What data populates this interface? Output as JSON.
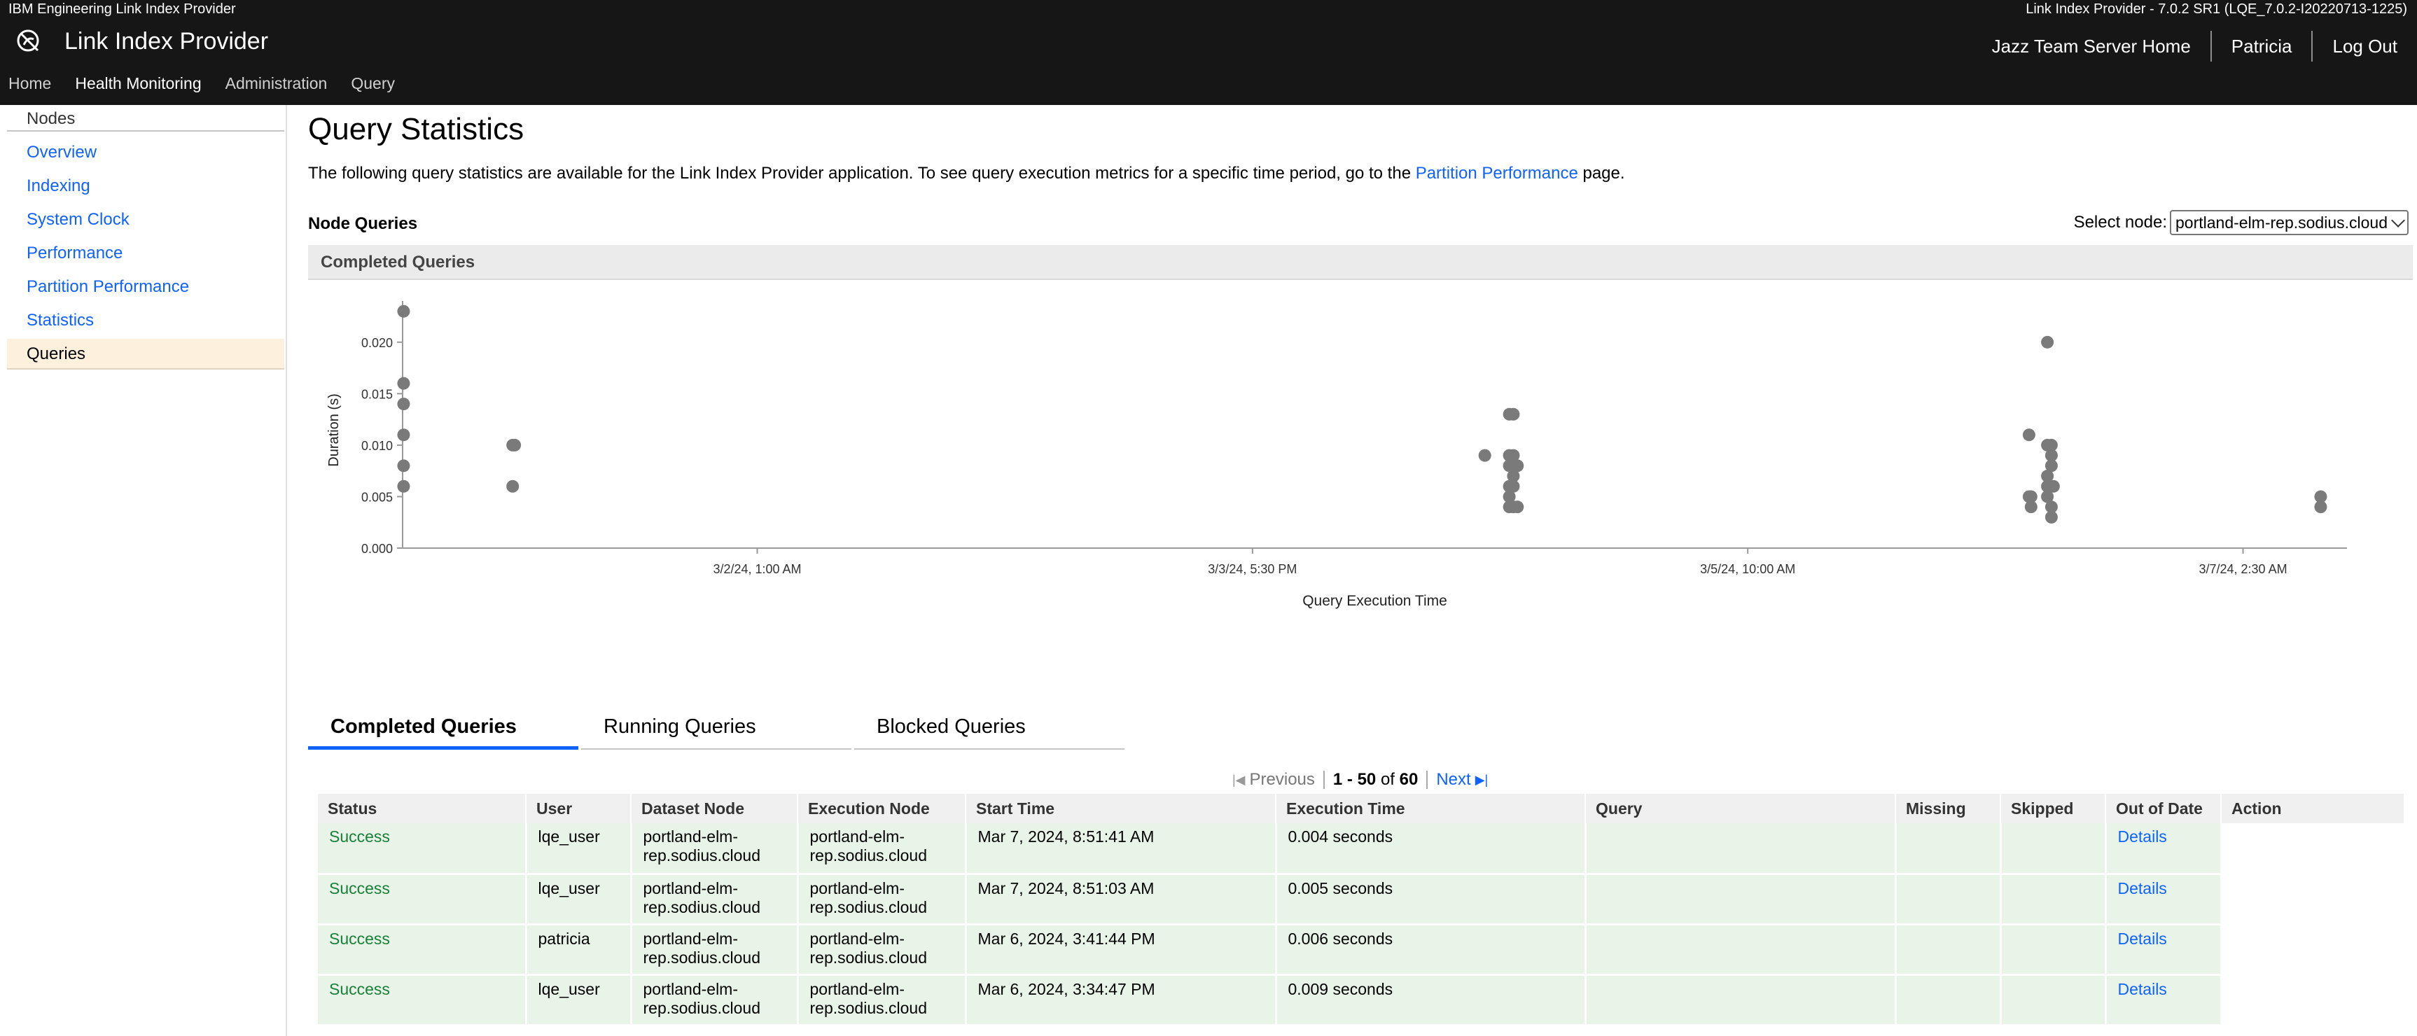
{
  "header": {
    "product": "IBM Engineering Link Index Provider",
    "version": "Link Index Provider - 7.0.2 SR1 (LQE_7.0.2-I20220713-1225)",
    "app_title": "Link Index Provider",
    "links": [
      "Jazz Team Server Home",
      "Patricia",
      "Log Out"
    ],
    "nav": [
      "Home",
      "Health Monitoring",
      "Administration",
      "Query"
    ],
    "active_nav": "Health Monitoring"
  },
  "sidebar": {
    "heading": "Nodes",
    "items": [
      "Overview",
      "Indexing",
      "System Clock",
      "Performance",
      "Partition Performance",
      "Statistics",
      "Queries"
    ],
    "active": "Queries"
  },
  "main": {
    "title": "Query Statistics",
    "intro_text": "The following query statistics are available for the Link Index Provider application. To see query execution metrics for a specific time period, go to the ",
    "intro_link": "Partition Performance",
    "intro_end": " page.",
    "node_queries_label": "Node Queries",
    "select_node_label": "Select node:",
    "select_node_value": "portland-elm-rep.sodius.cloud",
    "section_heading": "Completed Queries",
    "tabs": [
      "Completed Queries",
      "Running Queries",
      "Blocked Queries"
    ],
    "pager": {
      "previous": "Previous",
      "range": "1 - 50",
      "of_label": "of",
      "total": "60",
      "next": "Next"
    },
    "table": {
      "columns": [
        "Status",
        "User",
        "Dataset Node",
        "Execution Node",
        "Start Time",
        "Execution Time",
        "Query",
        "Missing",
        "Skipped",
        "Out of Date",
        "Action"
      ],
      "rows": [
        {
          "status": "Success",
          "user": "lqe_user",
          "dataset_node": "portland-elm-rep.sodius.cloud",
          "execution_node": "portland-elm-rep.sodius.cloud",
          "start_time": "Mar 7, 2024, 8:51:41 AM",
          "execution_time": "0.004 seconds",
          "query": "",
          "missing": "",
          "skipped": "",
          "out_of_date": "Details",
          "action": ""
        },
        {
          "status": "Success",
          "user": "lqe_user",
          "dataset_node": "portland-elm-rep.sodius.cloud",
          "execution_node": "portland-elm-rep.sodius.cloud",
          "start_time": "Mar 7, 2024, 8:51:03 AM",
          "execution_time": "0.005 seconds",
          "query": "",
          "missing": "",
          "skipped": "",
          "out_of_date": "Details",
          "action": ""
        },
        {
          "status": "Success",
          "user": "patricia",
          "dataset_node": "portland-elm-rep.sodius.cloud",
          "execution_node": "portland-elm-rep.sodius.cloud",
          "start_time": "Mar 6, 2024, 3:41:44 PM",
          "execution_time": "0.006 seconds",
          "query": "",
          "missing": "",
          "skipped": "",
          "out_of_date": "Details",
          "action": ""
        },
        {
          "status": "Success",
          "user": "lqe_user",
          "dataset_node": "portland-elm-rep.sodius.cloud",
          "execution_node": "portland-elm-rep.sodius.cloud",
          "start_time": "Mar 6, 2024, 3:34:47 PM",
          "execution_time": "0.009 seconds",
          "query": "",
          "missing": "",
          "skipped": "",
          "out_of_date": "Details",
          "action": ""
        }
      ]
    }
  },
  "colors": {
    "header_bg": "#161616",
    "link": "#0f62fe",
    "success": "#198038",
    "row_bg": "#e8f4e8",
    "point": "#7a7a7a",
    "active_side": "#fdf1de"
  },
  "chart_data": {
    "type": "scatter",
    "title": "",
    "xlabel": "Query Execution Time",
    "ylabel": "Duration (s)",
    "ylim": [
      0,
      0.024
    ],
    "y_ticks": [
      "0.000",
      "0.005",
      "0.010",
      "0.015",
      "0.020"
    ],
    "x_ticks": [
      "3/2/24, 1:00 AM",
      "3/3/24, 5:30 PM",
      "3/5/24, 10:00 AM",
      "3/7/24, 2:30 AM"
    ],
    "xlim": [
      "2024-02-29T20:00",
      "2024-03-07T11:00"
    ],
    "grid": false,
    "series": [
      {
        "points": [
          {
            "x": "2024-02-29T20:05",
            "y": 0.023
          },
          {
            "x": "2024-02-29T20:05",
            "y": 0.016
          },
          {
            "x": "2024-02-29T20:05",
            "y": 0.014
          },
          {
            "x": "2024-02-29T20:05",
            "y": 0.011
          },
          {
            "x": "2024-02-29T20:05",
            "y": 0.008
          },
          {
            "x": "2024-02-29T20:05",
            "y": 0.006
          },
          {
            "x": "2024-03-01T05:00",
            "y": 0.01
          },
          {
            "x": "2024-03-01T05:10",
            "y": 0.01
          },
          {
            "x": "2024-03-01T05:00",
            "y": 0.006
          },
          {
            "x": "2024-03-04T12:30",
            "y": 0.009
          },
          {
            "x": "2024-03-04T14:30",
            "y": 0.013
          },
          {
            "x": "2024-03-04T14:50",
            "y": 0.013
          },
          {
            "x": "2024-03-04T14:30",
            "y": 0.009
          },
          {
            "x": "2024-03-04T14:50",
            "y": 0.009
          },
          {
            "x": "2024-03-04T14:30",
            "y": 0.008
          },
          {
            "x": "2024-03-04T15:10",
            "y": 0.008
          },
          {
            "x": "2024-03-04T14:50",
            "y": 0.007
          },
          {
            "x": "2024-03-04T14:30",
            "y": 0.006
          },
          {
            "x": "2024-03-04T14:50",
            "y": 0.006
          },
          {
            "x": "2024-03-04T14:30",
            "y": 0.005
          },
          {
            "x": "2024-03-04T14:30",
            "y": 0.004
          },
          {
            "x": "2024-03-04T14:50",
            "y": 0.004
          },
          {
            "x": "2024-03-04T15:10",
            "y": 0.004
          },
          {
            "x": "2024-03-06T09:00",
            "y": 0.011
          },
          {
            "x": "2024-03-06T09:00",
            "y": 0.005
          },
          {
            "x": "2024-03-06T09:10",
            "y": 0.005
          },
          {
            "x": "2024-03-06T09:10",
            "y": 0.004
          },
          {
            "x": "2024-03-06T10:30",
            "y": 0.02
          },
          {
            "x": "2024-03-06T10:30",
            "y": 0.01
          },
          {
            "x": "2024-03-06T10:50",
            "y": 0.01
          },
          {
            "x": "2024-03-06T10:50",
            "y": 0.009
          },
          {
            "x": "2024-03-06T10:50",
            "y": 0.008
          },
          {
            "x": "2024-03-06T10:30",
            "y": 0.007
          },
          {
            "x": "2024-03-06T10:30",
            "y": 0.006
          },
          {
            "x": "2024-03-06T11:00",
            "y": 0.006
          },
          {
            "x": "2024-03-06T10:30",
            "y": 0.005
          },
          {
            "x": "2024-03-06T10:50",
            "y": 0.004
          },
          {
            "x": "2024-03-06T10:50",
            "y": 0.003
          },
          {
            "x": "2024-03-07T08:51",
            "y": 0.005
          },
          {
            "x": "2024-03-07T08:51",
            "y": 0.004
          }
        ]
      }
    ]
  }
}
